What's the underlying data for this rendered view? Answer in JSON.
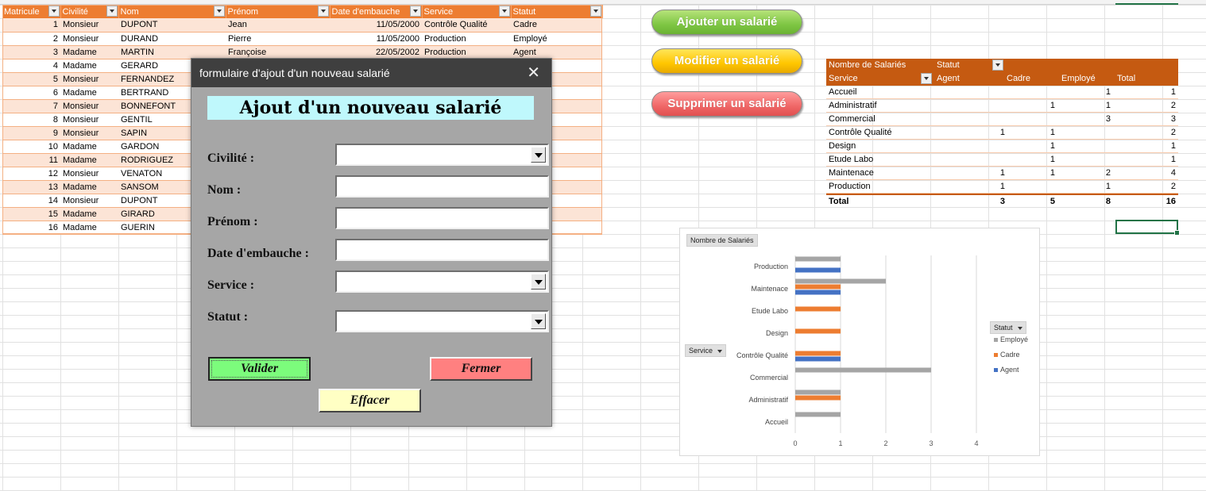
{
  "table": {
    "headers": [
      "Matricule",
      "Civilité",
      "Nom",
      "Prénom",
      "Date d'embauche",
      "Service",
      "Statut"
    ],
    "rows": [
      [
        "1",
        "Monsieur",
        "DUPONT",
        "Jean",
        "11/05/2000",
        "Contrôle Qualité",
        "Cadre"
      ],
      [
        "2",
        "Monsieur",
        "DURAND",
        "Pierre",
        "11/05/2000",
        "Production",
        "Employé"
      ],
      [
        "3",
        "Madame",
        "MARTIN",
        "Françoise",
        "22/05/2002",
        "Production",
        "Agent"
      ],
      [
        "4",
        "Madame",
        "GERARD",
        "",
        "",
        "",
        ""
      ],
      [
        "5",
        "Monsieur",
        "FERNANDEZ",
        "",
        "",
        "",
        ""
      ],
      [
        "6",
        "Madame",
        "BERTRAND",
        "",
        "",
        "",
        ""
      ],
      [
        "7",
        "Monsieur",
        "BONNEFONT",
        "",
        "",
        "",
        ""
      ],
      [
        "8",
        "Monsieur",
        "GENTIL",
        "",
        "",
        "",
        ""
      ],
      [
        "9",
        "Monsieur",
        "SAPIN",
        "",
        "",
        "",
        ""
      ],
      [
        "10",
        "Madame",
        "GARDON",
        "",
        "",
        "",
        ""
      ],
      [
        "11",
        "Madame",
        "RODRIGUEZ",
        "",
        "",
        "",
        ""
      ],
      [
        "12",
        "Monsieur",
        "VENATON",
        "",
        "",
        "",
        ""
      ],
      [
        "13",
        "Madame",
        "SANSOM",
        "",
        "",
        "",
        ""
      ],
      [
        "14",
        "Monsieur",
        "DUPONT",
        "",
        "",
        "",
        ""
      ],
      [
        "15",
        "Madame",
        "GIRARD",
        "",
        "",
        "",
        ""
      ],
      [
        "16",
        "Madame",
        "GUERIN",
        "",
        "",
        "",
        ""
      ]
    ]
  },
  "buttons": {
    "add": "Ajouter un salarié",
    "modify": "Modifier un salarié",
    "delete": "Supprimer un salarié"
  },
  "pivot": {
    "title": "Nombre de Salariés",
    "col_field": "Statut",
    "row_field": "Service",
    "cols": [
      "Agent",
      "Cadre",
      "Employé",
      "Total"
    ],
    "rows": [
      {
        "label": "Accueil",
        "agent": "",
        "cadre": "",
        "employe": "1",
        "total": "1"
      },
      {
        "label": "Administratif",
        "agent": "",
        "cadre": "1",
        "employe": "1",
        "total": "2"
      },
      {
        "label": "Commercial",
        "agent": "",
        "cadre": "",
        "employe": "3",
        "total": "3"
      },
      {
        "label": "Contrôle Qualité",
        "agent": "1",
        "cadre": "1",
        "employe": "",
        "total": "2"
      },
      {
        "label": "Design",
        "agent": "",
        "cadre": "1",
        "employe": "",
        "total": "1"
      },
      {
        "label": "Etude Labo",
        "agent": "",
        "cadre": "1",
        "employe": "",
        "total": "1"
      },
      {
        "label": "Maintenace",
        "agent": "1",
        "cadre": "1",
        "employe": "2",
        "total": "4"
      },
      {
        "label": "Production",
        "agent": "1",
        "cadre": "",
        "employe": "1",
        "total": "2"
      }
    ],
    "total": {
      "label": "Total",
      "agent": "3",
      "cadre": "5",
      "employe": "8",
      "total": "16"
    }
  },
  "chart_data": {
    "type": "bar",
    "orientation": "horizontal",
    "title": "Nombre de Salariés",
    "row_field_button": "Service",
    "legend_title": "Statut",
    "legend_position": "right",
    "categories": [
      "Accueil",
      "Administratif",
      "Commercial",
      "Contrôle Qualité",
      "Design",
      "Etude Labo",
      "Maintenace",
      "Production"
    ],
    "series": [
      {
        "name": "Agent",
        "color": "#4472c4",
        "values": [
          0,
          0,
          0,
          1,
          0,
          0,
          1,
          1
        ]
      },
      {
        "name": "Cadre",
        "color": "#ed7d31",
        "values": [
          0,
          1,
          0,
          1,
          1,
          1,
          1,
          0
        ]
      },
      {
        "name": "Employé",
        "color": "#a5a5a5",
        "values": [
          1,
          1,
          3,
          0,
          0,
          0,
          2,
          1
        ]
      }
    ],
    "xlim": [
      0,
      4
    ],
    "xticks": [
      "0",
      "1",
      "2",
      "3",
      "4"
    ],
    "grid": true
  },
  "dialog": {
    "window_title": "formulaire d'ajout d'un nouveau salarié",
    "close_glyph": "✕",
    "heading": "Ajout d'un nouveau salarié",
    "labels": {
      "civilite": "Civilité :",
      "nom": "Nom :",
      "prenom": "Prénom :",
      "date": "Date d'embauche :",
      "service": "Service :",
      "statut": "Statut :"
    },
    "values": {
      "civilite": "",
      "nom": "",
      "prenom": "",
      "date": "",
      "service": "",
      "statut": ""
    },
    "buttons": {
      "valider": "Valider",
      "fermer": "Fermer",
      "effacer": "Effacer"
    }
  }
}
